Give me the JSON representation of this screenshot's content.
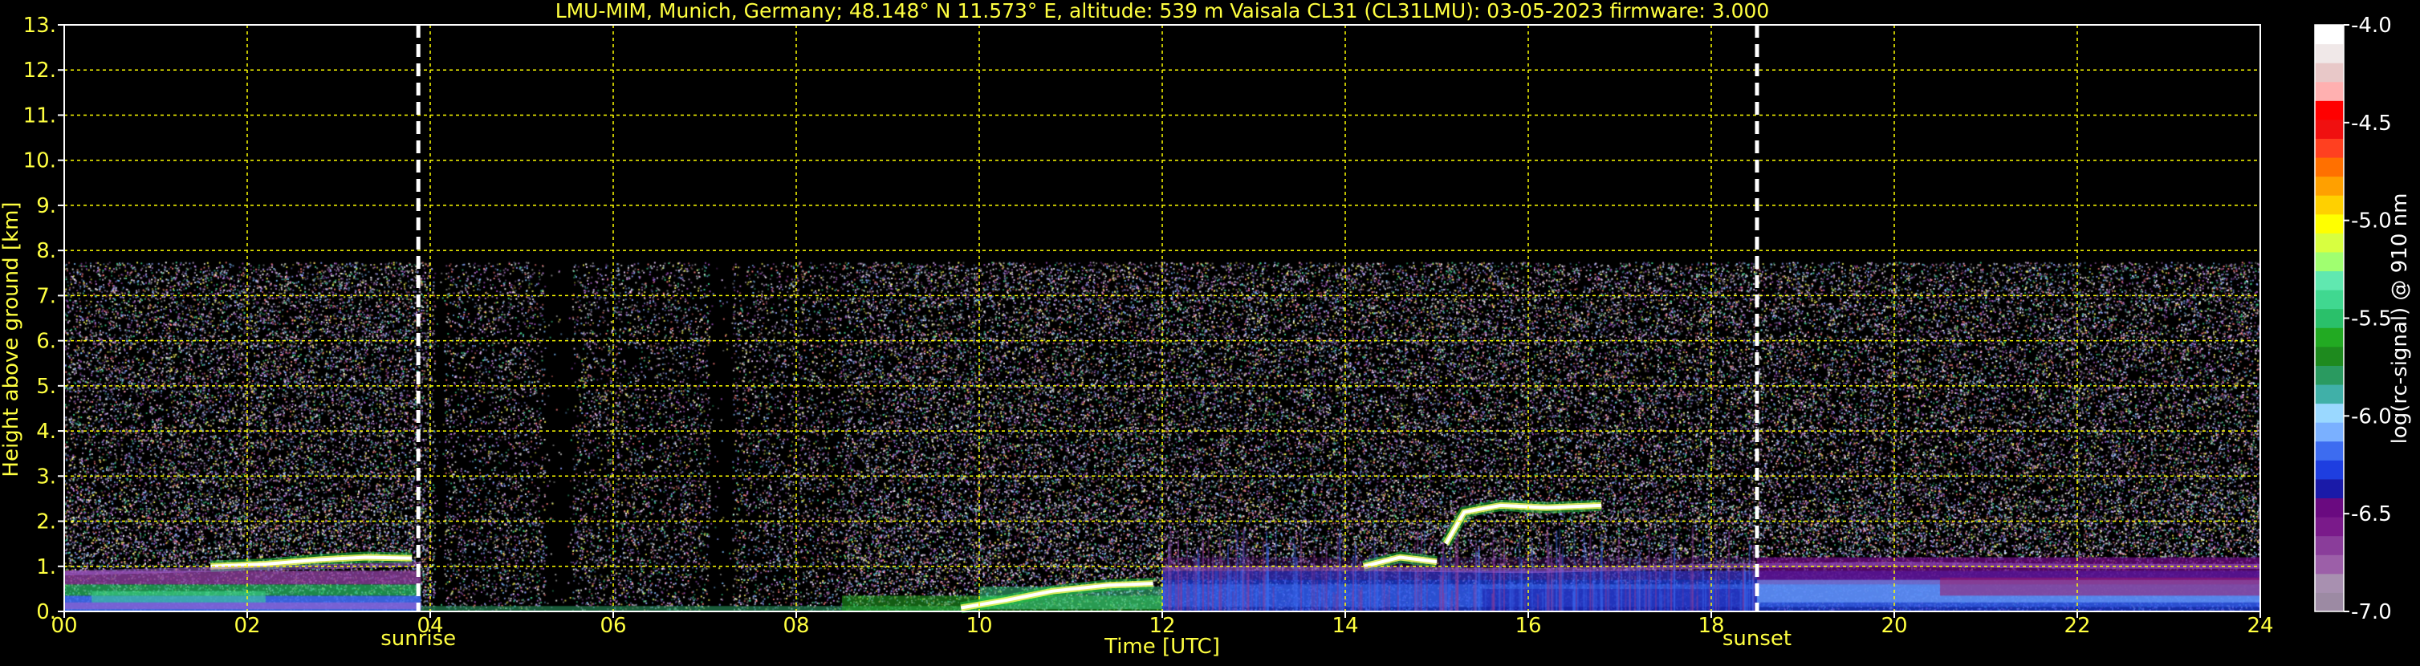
{
  "title": "LMU-MIM, Munich, Germany; 48.148° N 11.573° E, altitude: 539 m    Vaisala CL31 (CL31LMU): 03-05-2023    firmware: 3.000",
  "chart_data": {
    "type": "heatmap",
    "xlabel": "Time [UTC]",
    "ylabel": "Height above ground [km]",
    "xlim": [
      0,
      24
    ],
    "ylim": [
      0,
      13
    ],
    "x_ticks": [
      "00",
      "02",
      "04",
      "06",
      "08",
      "10",
      "12",
      "14",
      "16",
      "18",
      "20",
      "22",
      "24"
    ],
    "y_ticks": [
      "0.",
      "1.",
      "2.",
      "3.",
      "4.",
      "5.",
      "6.",
      "7.",
      "8.",
      "9.",
      "10.",
      "11.",
      "12.",
      "13."
    ],
    "grid": true,
    "markers": [
      {
        "label": "sunrise",
        "x": 3.87
      },
      {
        "label": "sunset",
        "x": 18.5
      }
    ],
    "colorbar": {
      "label": "log(rc-signal) @ 910 nm",
      "min": -7.0,
      "max": -4.0,
      "ticks": [
        "-4.0",
        "-4.5",
        "-5.0",
        "-5.5",
        "-6.0",
        "-6.5",
        "-7.0"
      ],
      "colors": [
        "#9c8aa3",
        "#a890b0",
        "#9c5fa8",
        "#8a3d9a",
        "#7a1a8a",
        "#6a0a80",
        "#1a1aa8",
        "#1e3ee0",
        "#3d6cf0",
        "#7ab0ff",
        "#9ad8ff",
        "#40b0a8",
        "#2a9a60",
        "#1e8a1e",
        "#22aa22",
        "#2ac06a",
        "#40d890",
        "#60e8b0",
        "#a0ff70",
        "#d8ff40",
        "#ffff00",
        "#ffd000",
        "#ffa000",
        "#ff7000",
        "#ff4020",
        "#f01010",
        "#ff0000",
        "#ffb0b0",
        "#e8c8c8",
        "#f0e8e8",
        "#ffffff"
      ]
    },
    "signal_top_km": 7.75,
    "noise_gaps": [
      [
        4.05,
        4.15
      ],
      [
        5.25,
        5.55
      ],
      [
        7.05,
        7.3
      ]
    ],
    "cloud_layers": [
      {
        "x": [
          1.6,
          2.2,
          2.8,
          3.3,
          3.8
        ],
        "y": [
          1.0,
          1.05,
          1.15,
          1.2,
          1.18
        ]
      },
      {
        "x": [
          9.8,
          10.3,
          10.8,
          11.4,
          11.9
        ],
        "y": [
          0.08,
          0.25,
          0.45,
          0.58,
          0.62
        ]
      },
      {
        "x": [
          15.1,
          15.3,
          15.7,
          16.2,
          16.8
        ],
        "y": [
          1.5,
          2.2,
          2.35,
          2.3,
          2.35
        ]
      },
      {
        "x": [
          14.2,
          14.6,
          15.0
        ],
        "y": [
          1.0,
          1.2,
          1.1
        ]
      }
    ],
    "boundary_layer": [
      {
        "x": [
          0,
          1,
          2,
          3,
          3.9
        ],
        "y": [
          0.85,
          0.9,
          0.95,
          1.0,
          1.05
        ]
      },
      {
        "x": [
          12,
          14,
          16,
          18,
          20,
          22,
          24
        ],
        "y": [
          0.95,
          0.95,
          0.9,
          1.0,
          1.05,
          1.0,
          1.0
        ]
      }
    ]
  }
}
